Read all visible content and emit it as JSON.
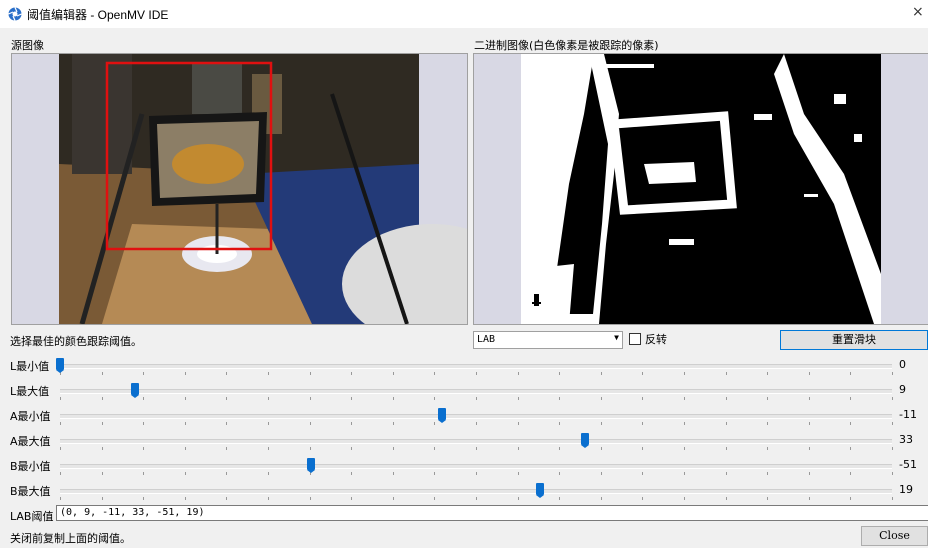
{
  "window": {
    "title": "阈值编辑器 - OpenMV IDE",
    "icon": "openmv-aperture-icon",
    "close_glyph": "×"
  },
  "source_image": {
    "label": "源图像"
  },
  "binary_image": {
    "label": "二进制图像(白色像素是被跟踪的像素)"
  },
  "instruction": "选择最佳的颜色跟踪阈值。",
  "colorspace": {
    "selected": "LAB"
  },
  "invert": {
    "label": "反转",
    "checked": false
  },
  "reset_button": "重置滑块",
  "sliders": [
    {
      "label": "L最小值",
      "value": "0",
      "min": 0,
      "max": 100,
      "num": 0
    },
    {
      "label": "L最大值",
      "value": "9",
      "min": 0,
      "max": 100,
      "num": 9
    },
    {
      "label": "A最小值",
      "value": "-11",
      "min": -128,
      "max": 127,
      "num": -11
    },
    {
      "label": "A最大值",
      "value": "33",
      "min": -128,
      "max": 127,
      "num": 33
    },
    {
      "label": "B最小值",
      "value": "-51",
      "min": -128,
      "max": 127,
      "num": -51
    },
    {
      "label": "B最大值",
      "value": "19",
      "min": -128,
      "max": 127,
      "num": 19
    }
  ],
  "lab_threshold": {
    "label": "LAB阈值",
    "value": "(0, 9, -11, 33, -51, 19)"
  },
  "footer_hint": "关闭前复制上面的阈值。",
  "close_button": "Close",
  "colors": {
    "accent": "#0a6fcf",
    "focus_border": "#0078d7",
    "roi": "#e01010"
  }
}
